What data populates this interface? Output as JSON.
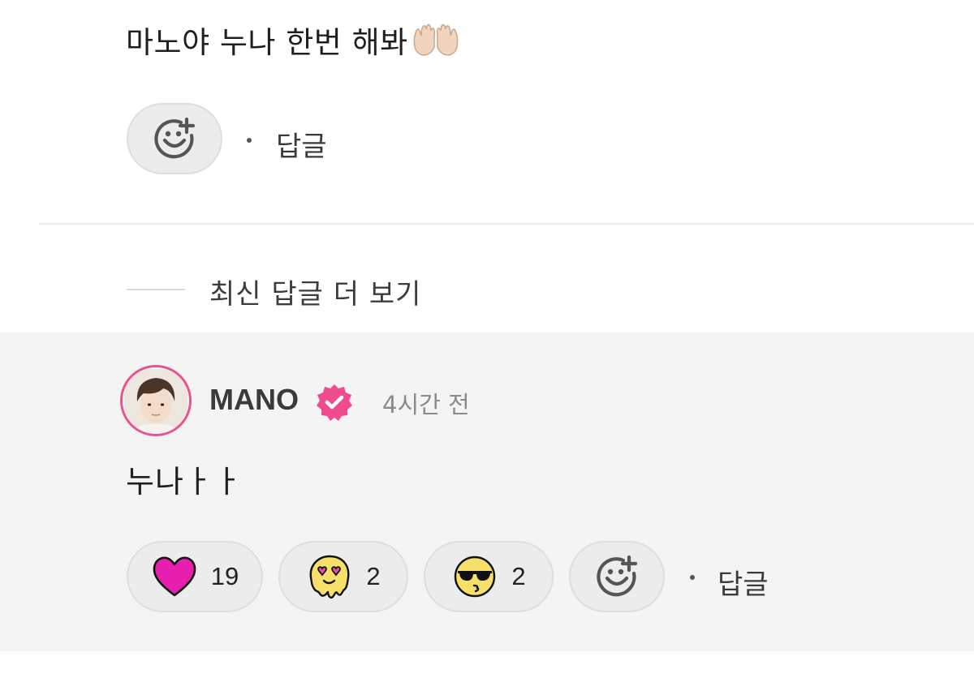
{
  "top_comment": {
    "text": "마노야 누나 한번 해봐",
    "emoji": "raising-hands-emoji",
    "reply_label": "답글"
  },
  "more_replies": {
    "label": "최신 답글 더 보기"
  },
  "reply": {
    "author": "MANO",
    "verified": true,
    "timestamp": "4시간 전",
    "text": "누나ㅏㅏ",
    "reply_label": "답글",
    "reactions": [
      {
        "icon": "heart-icon",
        "count": "19"
      },
      {
        "icon": "melting-heart-eyes-icon",
        "count": "2"
      },
      {
        "icon": "sunglasses-kiss-icon",
        "count": "2"
      }
    ]
  },
  "colors": {
    "accent_pink": "#e9518f",
    "heart": "#e81fae",
    "pill_bg": "#ececec",
    "reply_bg": "#f4f4f4"
  }
}
